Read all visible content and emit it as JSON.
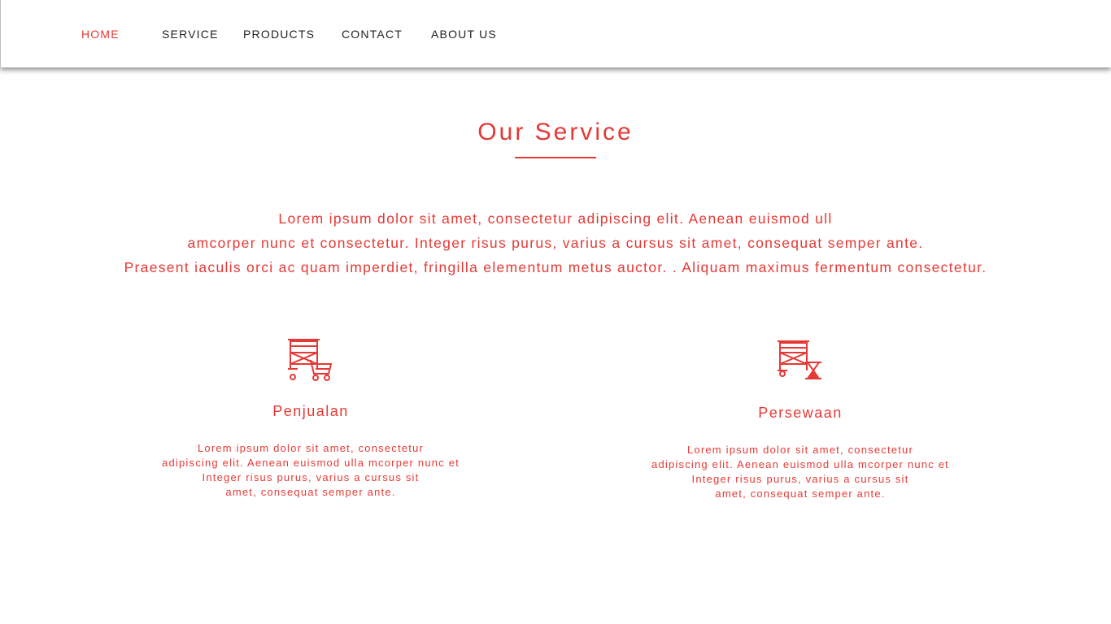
{
  "colors": {
    "accent": "#e53935",
    "nav_text": "#222222",
    "background": "#ffffff"
  },
  "nav": {
    "items": [
      {
        "label": "HOME",
        "active": true
      },
      {
        "label": "SERVICE",
        "active": false
      },
      {
        "label": "PRODUCTS",
        "active": false
      },
      {
        "label": "CONTACT",
        "active": false
      },
      {
        "label": "ABOUT US",
        "active": false
      }
    ]
  },
  "section": {
    "title": "Our Service",
    "intro_lines": [
      "Lorem ipsum dolor sit amet, consectetur adipiscing elit. Aenean euismod ull",
      "amcorper nunc et consectetur. Integer risus purus, varius a cursus sit amet, consequat semper ante.",
      "Praesent iaculis orci ac quam imperdiet, fringilla elementum metus auctor. . Aliquam maximus fermentum consectetur."
    ]
  },
  "services": [
    {
      "icon": "scaffolding-cart-icon",
      "title": "Penjualan",
      "text_lines": [
        "Lorem ipsum dolor sit amet, consectetur",
        "adipiscing elit. Aenean euismod ulla mcorper nunc et",
        "Integer risus purus, varius a cursus sit",
        "amet, consequat semper ante."
      ]
    },
    {
      "icon": "scaffolding-hourglass-icon",
      "title": "Persewaan",
      "text_lines": [
        "Lorem ipsum dolor sit amet, consectetur",
        "adipiscing elit. Aenean euismod ulla mcorper nunc et",
        "Integer risus purus, varius a cursus sit",
        "amet, consequat semper ante."
      ]
    }
  ]
}
